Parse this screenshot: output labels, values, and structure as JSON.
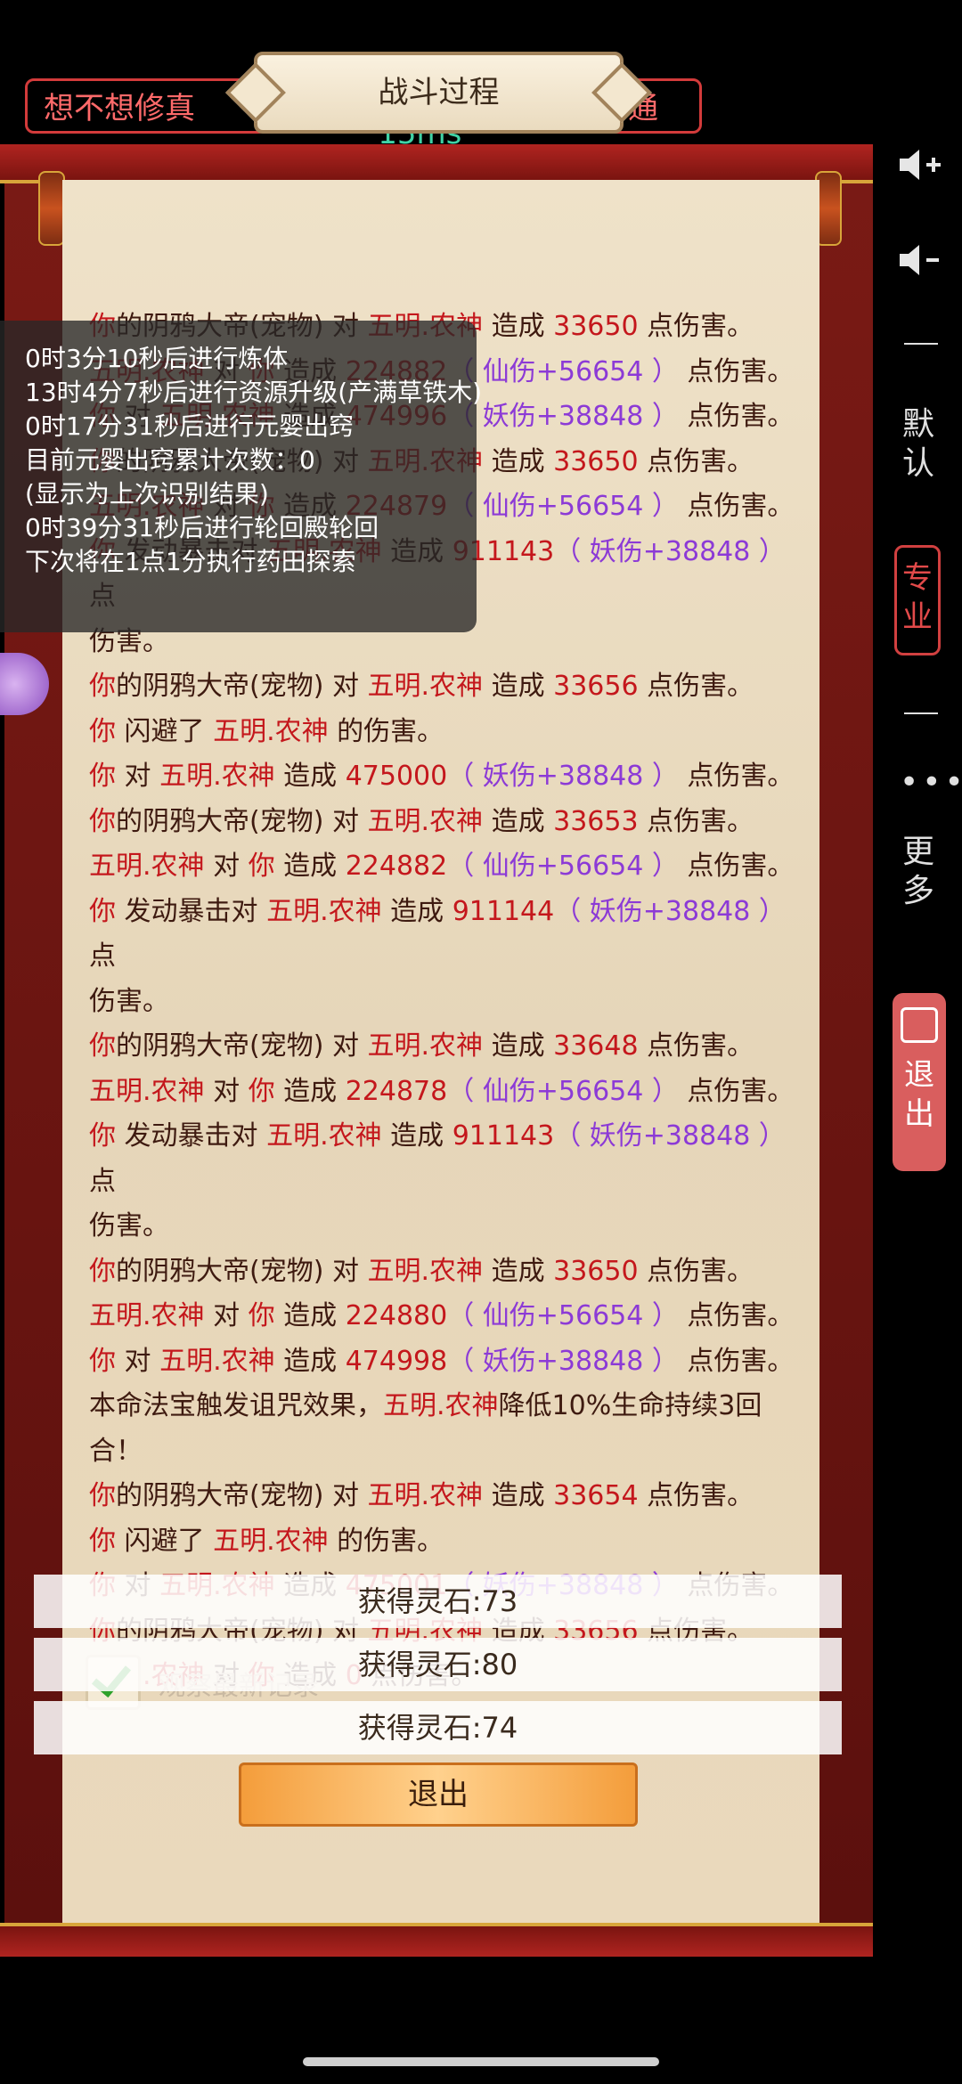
{
  "top": {
    "pill_name": "想不想修真",
    "pill_net": "移动 15ms",
    "pill_mode": "普通"
  },
  "panel": {
    "title": "战斗过程"
  },
  "log": [
    [
      [
        "你",
        "r"
      ],
      [
        "的阴鸦大帝(宠物) 对 ",
        "k"
      ],
      [
        "五明.农神",
        "r"
      ],
      [
        " 造成 ",
        "k"
      ],
      [
        "33650",
        "r"
      ],
      [
        " 点伤害。",
        "k"
      ]
    ],
    [
      [
        "五明.农神",
        "r"
      ],
      [
        " 对 ",
        "k"
      ],
      [
        "你",
        "r"
      ],
      [
        " 造成 ",
        "k"
      ],
      [
        "224882",
        "r"
      ],
      [
        "（ 仙伤+56654 ）",
        "p"
      ],
      [
        " 点伤害。",
        "k"
      ]
    ],
    [
      [
        "你",
        "r"
      ],
      [
        " 对 ",
        "k"
      ],
      [
        "五明.农神",
        "r"
      ],
      [
        " 造成 ",
        "k"
      ],
      [
        "474996",
        "r"
      ],
      [
        "（ 妖伤+38848 ）",
        "p"
      ],
      [
        " 点伤害。",
        "k"
      ]
    ],
    [
      [
        "你",
        "r"
      ],
      [
        "的阴鸦大帝(宠物) 对 ",
        "k"
      ],
      [
        "五明.农神",
        "r"
      ],
      [
        " 造成 ",
        "k"
      ],
      [
        "33650",
        "r"
      ],
      [
        " 点伤害。",
        "k"
      ]
    ],
    [
      [
        "五明.农神",
        "r"
      ],
      [
        " 对 ",
        "k"
      ],
      [
        "你",
        "r"
      ],
      [
        " 造成 ",
        "k"
      ],
      [
        "224879",
        "r"
      ],
      [
        "（ 仙伤+56654 ）",
        "p"
      ],
      [
        " 点伤害。",
        "k"
      ]
    ],
    [
      [
        "你",
        "r"
      ],
      [
        " 发动暴击对 ",
        "k"
      ],
      [
        "五明.农神",
        "r"
      ],
      [
        " 造成 ",
        "k"
      ],
      [
        "911143",
        "r"
      ],
      [
        "（ 妖伤+38848 ）",
        "p"
      ],
      [
        "点",
        "k"
      ]
    ],
    [
      [
        "伤害。",
        "k"
      ]
    ],
    [
      [
        "你",
        "r"
      ],
      [
        "的阴鸦大帝(宠物) 对 ",
        "k"
      ],
      [
        "五明.农神",
        "r"
      ],
      [
        " 造成 ",
        "k"
      ],
      [
        "33656",
        "r"
      ],
      [
        " 点伤害。",
        "k"
      ]
    ],
    [
      [
        "你",
        "r"
      ],
      [
        " 闪避了 ",
        "k"
      ],
      [
        "五明.农神",
        "r"
      ],
      [
        " 的伤害。",
        "k"
      ]
    ],
    [
      [
        "你",
        "r"
      ],
      [
        " 对 ",
        "k"
      ],
      [
        "五明.农神",
        "r"
      ],
      [
        " 造成 ",
        "k"
      ],
      [
        "475000",
        "r"
      ],
      [
        "（ 妖伤+38848 ）",
        "p"
      ],
      [
        " 点伤害。",
        "k"
      ]
    ],
    [
      [
        "你",
        "r"
      ],
      [
        "的阴鸦大帝(宠物) 对 ",
        "k"
      ],
      [
        "五明.农神",
        "r"
      ],
      [
        " 造成 ",
        "k"
      ],
      [
        "33653",
        "r"
      ],
      [
        " 点伤害。",
        "k"
      ]
    ],
    [
      [
        "五明.农神",
        "r"
      ],
      [
        " 对 ",
        "k"
      ],
      [
        "你",
        "r"
      ],
      [
        " 造成 ",
        "k"
      ],
      [
        "224882",
        "r"
      ],
      [
        "（ 仙伤+56654 ）",
        "p"
      ],
      [
        " 点伤害。",
        "k"
      ]
    ],
    [
      [
        "你",
        "r"
      ],
      [
        " 发动暴击对 ",
        "k"
      ],
      [
        "五明.农神",
        "r"
      ],
      [
        " 造成 ",
        "k"
      ],
      [
        "911144",
        "r"
      ],
      [
        "（ 妖伤+38848 ）",
        "p"
      ],
      [
        "点",
        "k"
      ]
    ],
    [
      [
        "伤害。",
        "k"
      ]
    ],
    [
      [
        "你",
        "r"
      ],
      [
        "的阴鸦大帝(宠物) 对 ",
        "k"
      ],
      [
        "五明.农神",
        "r"
      ],
      [
        " 造成 ",
        "k"
      ],
      [
        "33648",
        "r"
      ],
      [
        " 点伤害。",
        "k"
      ]
    ],
    [
      [
        "五明.农神",
        "r"
      ],
      [
        " 对 ",
        "k"
      ],
      [
        "你",
        "r"
      ],
      [
        " 造成 ",
        "k"
      ],
      [
        "224878",
        "r"
      ],
      [
        "（ 仙伤+56654 ）",
        "p"
      ],
      [
        " 点伤害。",
        "k"
      ]
    ],
    [
      [
        "你",
        "r"
      ],
      [
        " 发动暴击对 ",
        "k"
      ],
      [
        "五明.农神",
        "r"
      ],
      [
        " 造成 ",
        "k"
      ],
      [
        "911143",
        "r"
      ],
      [
        "（ 妖伤+38848 ）",
        "p"
      ],
      [
        "点",
        "k"
      ]
    ],
    [
      [
        "伤害。",
        "k"
      ]
    ],
    [
      [
        "你",
        "r"
      ],
      [
        "的阴鸦大帝(宠物) 对 ",
        "k"
      ],
      [
        "五明.农神",
        "r"
      ],
      [
        " 造成 ",
        "k"
      ],
      [
        "33650",
        "r"
      ],
      [
        " 点伤害。",
        "k"
      ]
    ],
    [
      [
        "五明.农神",
        "r"
      ],
      [
        " 对 ",
        "k"
      ],
      [
        "你",
        "r"
      ],
      [
        " 造成 ",
        "k"
      ],
      [
        "224880",
        "r"
      ],
      [
        "（ 仙伤+56654 ）",
        "p"
      ],
      [
        " 点伤害。",
        "k"
      ]
    ],
    [
      [
        "你",
        "r"
      ],
      [
        " 对 ",
        "k"
      ],
      [
        "五明.农神",
        "r"
      ],
      [
        " 造成 ",
        "k"
      ],
      [
        "474998",
        "r"
      ],
      [
        "（ 妖伤+38848 ）",
        "p"
      ],
      [
        " 点伤害。",
        "k"
      ]
    ],
    [
      [
        "本命法宝触发诅咒效果，",
        "k"
      ],
      [
        "五明.农神",
        "r"
      ],
      [
        "降低10%生命持续3回",
        "k"
      ]
    ],
    [
      [
        "合！",
        "k"
      ]
    ],
    [
      [
        "你",
        "r"
      ],
      [
        "的阴鸦大帝(宠物) 对 ",
        "k"
      ],
      [
        "五明.农神",
        "r"
      ],
      [
        " 造成 ",
        "k"
      ],
      [
        "33654",
        "r"
      ],
      [
        " 点伤害。",
        "k"
      ]
    ],
    [
      [
        "你",
        "r"
      ],
      [
        " 闪避了 ",
        "k"
      ],
      [
        "五明.农神",
        "r"
      ],
      [
        " 的伤害。",
        "k"
      ]
    ],
    [
      [
        "你",
        "r"
      ],
      [
        " 对 ",
        "k"
      ],
      [
        "五明.农神",
        "r"
      ],
      [
        " 造成 ",
        "k"
      ],
      [
        "475001",
        "r"
      ],
      [
        "（ 妖伤+38848 ）",
        "p"
      ],
      [
        " 点伤害。",
        "k"
      ]
    ],
    [
      [
        "你",
        "r"
      ],
      [
        "的阴鸦大帝(宠物) 对 ",
        "k"
      ],
      [
        "五明.农神",
        "r"
      ],
      [
        " 造成 ",
        "k"
      ],
      [
        "33656",
        "r"
      ],
      [
        " 点伤害。",
        "k"
      ]
    ],
    [
      [
        "五明.农神",
        "r"
      ],
      [
        " 对 ",
        "k"
      ],
      [
        "你",
        "r"
      ],
      [
        " 造成 ",
        "k"
      ],
      [
        "0",
        "r"
      ],
      [
        " 点伤害。",
        "k"
      ]
    ]
  ],
  "overlay": [
    "0时3分10秒后进行炼体",
    "13时4分7秒后进行资源升级(产满草铁木)",
    "0时17分31秒后进行元婴出窍",
    "目前元婴出窍累计次数：0",
    "(显示为上次识别结果)",
    "0时39分31秒后进行轮回殿轮回",
    "下次将在1点1分执行药田探索"
  ],
  "rewards": [
    "获得灵石:73",
    "获得灵石:80",
    "获得灵石:74"
  ],
  "observe_label": "观察最新记录",
  "exit_label": "退出",
  "side": {
    "default_label": "默认",
    "pro_label": "专业",
    "more_label": "更多",
    "exit_label": "退出",
    "vol_up": "volume-up-icon",
    "vol_down": "volume-down-icon"
  },
  "colors": {
    "damage_red": "#c4171c",
    "bonus_purple": "#8c3ad6",
    "accent_green": "#3fd3a6"
  }
}
